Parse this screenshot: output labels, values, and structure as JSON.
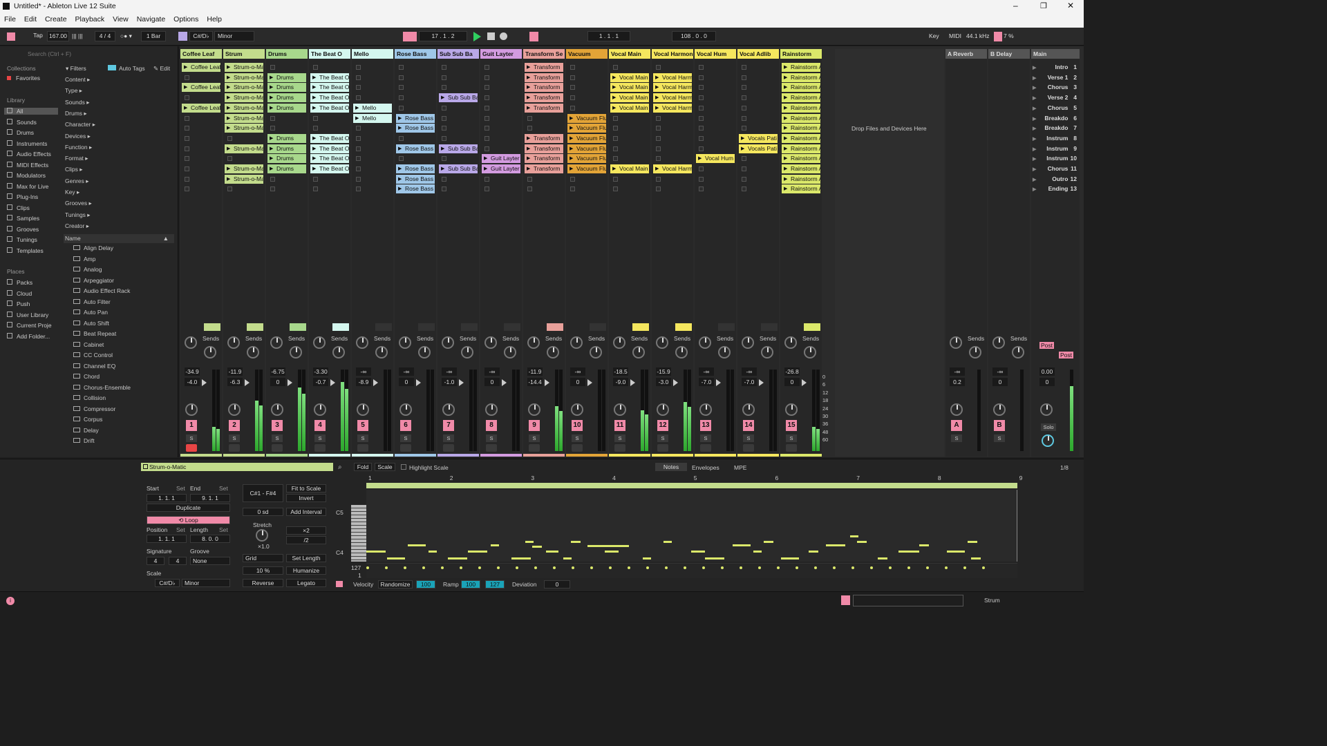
{
  "window": {
    "title": "Untitled* - Ableton Live 12 Suite"
  },
  "menu": [
    "File",
    "Edit",
    "Create",
    "Playback",
    "View",
    "Navigate",
    "Options",
    "Help"
  ],
  "controls": {
    "tap": "Tap",
    "tempo": "167.00",
    "signature": "4 / 4",
    "quantize": "1 Bar",
    "key": "C#/D♭",
    "scale": "Minor",
    "position": "17 .  1 .  2",
    "loop_start": "1 .  1 .  1",
    "loop_length": "108 .  0 .  0",
    "key_label": "Key",
    "midi_label": "MIDI",
    "sample_rate": "44.1 kHz",
    "cpu": "7 %"
  },
  "browser": {
    "search_placeholder": "Search (Ctrl + F)",
    "collections_label": "Collections",
    "favorites": "Favorites",
    "library_label": "Library",
    "library": [
      "All",
      "Sounds",
      "Drums",
      "Instruments",
      "Audio Effects",
      "MIDI Effects",
      "Modulators",
      "Max for Live",
      "Plug-Ins",
      "Clips",
      "Samples",
      "Grooves",
      "Tunings",
      "Templates"
    ],
    "places_label": "Places",
    "places": [
      "Packs",
      "Cloud",
      "Push",
      "User Library",
      "Current Proje",
      "Add Folder..."
    ],
    "filters": "Filters",
    "auto_tags": "Auto Tags",
    "edit": "Edit",
    "filter_items": [
      "Content",
      "Type",
      "Sounds",
      "Drums",
      "Character",
      "Devices",
      "Function",
      "Format",
      "Clips",
      "Genres",
      "Key",
      "Grooves",
      "Tunings",
      "Creator"
    ],
    "name_header": "Name",
    "items": [
      "Align Delay",
      "Amp",
      "Analog",
      "Arpeggiator",
      "Audio Effect Rack",
      "Auto Filter",
      "Auto Pan",
      "Auto Shift",
      "Beat Repeat",
      "Cabinet",
      "CC Control",
      "Channel EQ",
      "Chord",
      "Chorus-Ensemble",
      "Collision",
      "Compressor",
      "Corpus",
      "Delay",
      "Drift"
    ]
  },
  "tracks": [
    {
      "name": "Coffee Leaf",
      "color": "#c3dc8c",
      "clips": [
        0,
        2,
        4
      ],
      "clip": "Coffee Leaf",
      "vol": "-34.9",
      "pan": "-4.0",
      "num": "1",
      "level": 0.3
    },
    {
      "name": "Strum",
      "color": "#c3dc8c",
      "clips": [
        0,
        1,
        2,
        3,
        4,
        5,
        6,
        8,
        10,
        11
      ],
      "clip": "Strum-o-Matic",
      "vol": "-11.9",
      "pan": "-6.3",
      "num": "2",
      "level": 0.62
    },
    {
      "name": "Drums",
      "color": "#a8d88c",
      "clips": [
        1,
        2,
        3,
        4,
        7,
        8,
        9,
        10
      ],
      "clip": "Drums",
      "vol": "-6.75",
      "pan": "0",
      "num": "3",
      "level": 0.78
    },
    {
      "name": "The Beat O",
      "color": "#d4f7ef",
      "clips": [
        1,
        2,
        3,
        4,
        7,
        8,
        9,
        10
      ],
      "clip": "The Beat Of",
      "vol": "-3.30",
      "pan": "-0.7",
      "num": "4",
      "level": 0.85
    },
    {
      "name": "Mello",
      "color": "#d4f7ef",
      "clips": [
        4,
        5
      ],
      "clip": "Mello",
      "vol": "-∞",
      "pan": "-8.9",
      "num": "5",
      "level": 0
    },
    {
      "name": "Rose Bass",
      "color": "#9fc7e8",
      "clips": [
        5,
        6,
        8,
        10,
        11,
        12
      ],
      "clip": "Rose Bass",
      "vol": "-∞",
      "pan": "0",
      "num": "6",
      "level": 0
    },
    {
      "name": "Sub Sub Ba",
      "color": "#b9a8e8",
      "clips": [
        3,
        8,
        10
      ],
      "clip": "Sub Sub Bass",
      "vol": "-∞",
      "pan": "-1.0",
      "num": "7",
      "level": 0
    },
    {
      "name": "Guit Layter",
      "color": "#d39be0",
      "clips": [
        9,
        10
      ],
      "clip": "Guit Layter",
      "vol": "-∞",
      "pan": "0",
      "num": "8",
      "level": 0
    },
    {
      "name": "Transform Se",
      "color": "#e8a09a",
      "clips": [
        0,
        1,
        2,
        3,
        4,
        7,
        8,
        9,
        10
      ],
      "clip": "Transform",
      "vol": "-11.9",
      "pan": "-14.4",
      "num": "9",
      "level": 0.55
    },
    {
      "name": "Vacuum",
      "color": "#e3a437",
      "clips": [
        5,
        6,
        7,
        8,
        9,
        10
      ],
      "clip": "Vacuum Flu",
      "vol": "-∞",
      "pan": "0",
      "num": "10",
      "level": 0
    },
    {
      "name": "Vocal Main",
      "color": "#f5e75e",
      "clips": [
        1,
        2,
        3,
        4,
        10
      ],
      "clip": "Vocal Main",
      "vol": "-18.5",
      "pan": "-9.0",
      "num": "11",
      "level": 0.5
    },
    {
      "name": "Vocal Harmon",
      "color": "#f5e75e",
      "clips": [
        1,
        2,
        3,
        4,
        10
      ],
      "clip": "Vocal Harm",
      "vol": "-15.9",
      "pan": "-3.0",
      "num": "12",
      "level": 0.6
    },
    {
      "name": "Vocal Hum",
      "color": "#f5e75e",
      "clips": [
        9
      ],
      "clip": "Vocal Hum",
      "vol": "-∞",
      "pan": "-7.0",
      "num": "13",
      "level": 0
    },
    {
      "name": "Vocal Adlib",
      "color": "#f5e75e",
      "clips": [
        7,
        8
      ],
      "clip": "Vocals Pati",
      "vol": "-∞",
      "pan": "-7.0",
      "num": "14",
      "level": 0
    },
    {
      "name": "Rainstorm",
      "color": "#dbe86a",
      "clips": [
        0,
        1,
        2,
        3,
        4,
        5,
        6,
        7,
        8,
        9,
        10,
        11,
        12
      ],
      "clip": "Rainstorm Auto",
      "vol": "-26.8",
      "pan": "0",
      "num": "15",
      "level": 0.3
    }
  ],
  "drop_text": "Drop Files and Devices Here",
  "returns": [
    {
      "name": "A Reverb",
      "vol": "-∞",
      "pan": "0.2",
      "btn": "A"
    },
    {
      "name": "B Delay",
      "vol": "-∞",
      "pan": "0",
      "btn": "B"
    }
  ],
  "main": {
    "name": "Main",
    "vol": "0.00",
    "pan": "0",
    "solo": "Solo",
    "post": "Post"
  },
  "scenes": [
    {
      "name": "Intro",
      "n": "1"
    },
    {
      "name": "Verse 1",
      "n": "2"
    },
    {
      "name": "Chorus",
      "n": "3"
    },
    {
      "name": "Verse 2",
      "n": "4"
    },
    {
      "name": "Chorus",
      "n": "5"
    },
    {
      "name": "Breakdo",
      "n": "6"
    },
    {
      "name": "Breakdo",
      "n": "7"
    },
    {
      "name": "Instrum",
      "n": "8"
    },
    {
      "name": "Instrum",
      "n": "9"
    },
    {
      "name": "Instrum",
      "n": "10"
    },
    {
      "name": "Chorus",
      "n": "11"
    },
    {
      "name": "Outro",
      "n": "12"
    },
    {
      "name": "Ending",
      "n": "13"
    }
  ],
  "mixer": {
    "sends": "Sends",
    "a": "A",
    "b": "B",
    "s": "S",
    "meter_scale": [
      "0",
      "6",
      "12",
      "18",
      "24",
      "30",
      "36",
      "48",
      "60"
    ]
  },
  "clip_detail": {
    "name": "Strum-o-Matic",
    "start": "Start",
    "end": "End",
    "set": "Set",
    "start_val": "1.  1.  1",
    "end_val": "9.  1.  1",
    "duplicate": "Duplicate",
    "loop": "Loop",
    "position": "Position",
    "length": "Length",
    "pos_val": "1.  1.  1",
    "len_val": "8.  0.  0",
    "signature": "Signature",
    "groove": "Groove",
    "sig_num": "4",
    "sig_den": "4",
    "groove_val": "None",
    "scale": "Scale",
    "scale_key": "C#/D♭",
    "scale_name": "Minor",
    "range": "C#1 - F#4",
    "fit": "Fit to Scale",
    "invert": "Invert",
    "sd": "0 sd",
    "add_interval": "Add Interval",
    "stretch": "Stretch",
    "x2": "×2",
    "div2": "/2",
    "stretch_val": "×1.0",
    "grid": "Grid",
    "set_length": "Set Length",
    "humanize_val": "10 %",
    "humanize": "Humanize",
    "reverse": "Reverse",
    "legato": "Legato"
  },
  "piano_roll": {
    "fold": "Fold",
    "scale": "Scale",
    "highlight": "Highlight Scale",
    "tabs": [
      "Notes",
      "Envelopes",
      "MPE"
    ],
    "grid_sel": "1/8",
    "bars": [
      "1",
      "2",
      "3",
      "4",
      "5",
      "6",
      "7",
      "8",
      "9"
    ],
    "c5": "C5",
    "c4": "C4",
    "v127": "127",
    "v1": "1"
  },
  "velocity_bar": {
    "velocity": "Velocity",
    "randomize": "Randomize",
    "rand_val": "100",
    "ramp": "Ramp",
    "ramp_a": "100",
    "ramp_b": "127",
    "deviation": "Deviation",
    "dev_val": "0"
  },
  "status": {
    "track": "Strum"
  }
}
